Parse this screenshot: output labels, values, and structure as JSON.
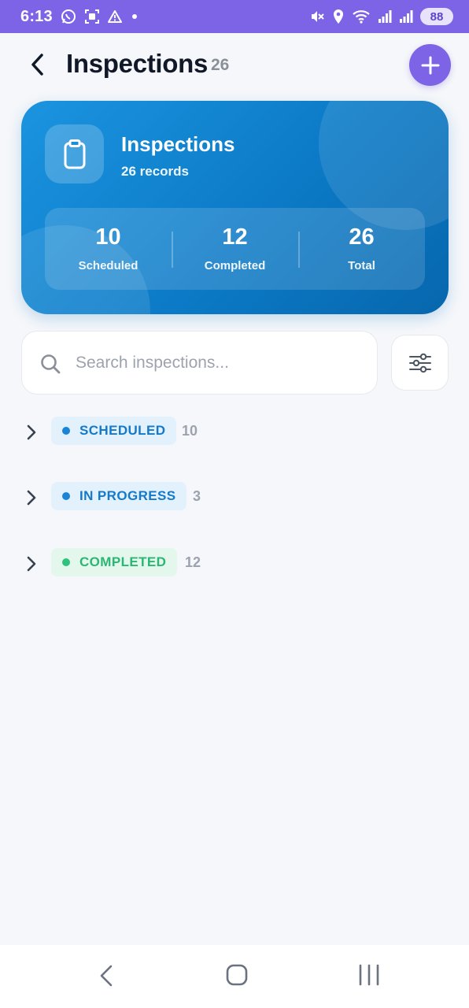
{
  "status_bar": {
    "time": "6:13",
    "battery": "88",
    "left_icons": [
      "whatsapp-icon",
      "screenshot-icon",
      "warning-icon",
      "dot-icon"
    ],
    "right_icons": [
      "mute-icon",
      "location-icon",
      "wifi-icon",
      "signal-icon",
      "signal-icon",
      "battery-icon"
    ],
    "color": "#7d63e6"
  },
  "header": {
    "title": "Inspections",
    "count": "26",
    "back_icon": "back-arrow-icon",
    "add_icon": "plus-icon",
    "accent_color": "#7d63e6"
  },
  "hero": {
    "icon": "clipboard-icon",
    "title": "Inspections",
    "subtitle": "26 records",
    "stats": [
      {
        "value": "10",
        "label": "Scheduled"
      },
      {
        "value": "12",
        "label": "Completed"
      },
      {
        "value": "26",
        "label": "Total"
      }
    ],
    "color": "#0b78c4"
  },
  "search": {
    "placeholder": "Search inspections...",
    "value": "",
    "icon": "search-icon",
    "filter_icon": "sliders-icon"
  },
  "groups": [
    {
      "label": "SCHEDULED",
      "count": "10",
      "text_color": "#1479c9",
      "bg_color": "#e3f1fd",
      "dot_color": "#1a85d6"
    },
    {
      "label": "IN PROGRESS",
      "count": "3",
      "text_color": "#1479c9",
      "bg_color": "#e3f1fd",
      "dot_color": "#1a85d6"
    },
    {
      "label": "COMPLETED",
      "count": "12",
      "text_color": "#2bb673",
      "bg_color": "#e3f7ec",
      "dot_color": "#2fc27c"
    }
  ],
  "nav_bar": {
    "icons": [
      "nav-back-icon",
      "home-icon",
      "recents-icon"
    ]
  }
}
